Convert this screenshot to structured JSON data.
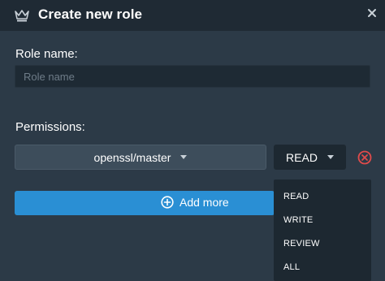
{
  "dialog": {
    "title": "Create new role",
    "title_icon": "crown-icon",
    "close_icon": "close-icon"
  },
  "role_name": {
    "label": "Role name:",
    "placeholder": "Role name",
    "value": ""
  },
  "permissions": {
    "label": "Permissions:",
    "rows": [
      {
        "repository": "openssl/master",
        "level": "READ",
        "remove_icon": "remove-circle-icon"
      }
    ]
  },
  "add_more": {
    "label": "Add more",
    "icon": "plus-circle-icon"
  },
  "level_dropdown": {
    "options": [
      "READ",
      "WRITE",
      "REVIEW",
      "ALL"
    ]
  },
  "colors": {
    "background": "#2c3a47",
    "titlebar": "#1f2a34",
    "accent": "#2a8fd4",
    "danger": "#e04b4b"
  }
}
